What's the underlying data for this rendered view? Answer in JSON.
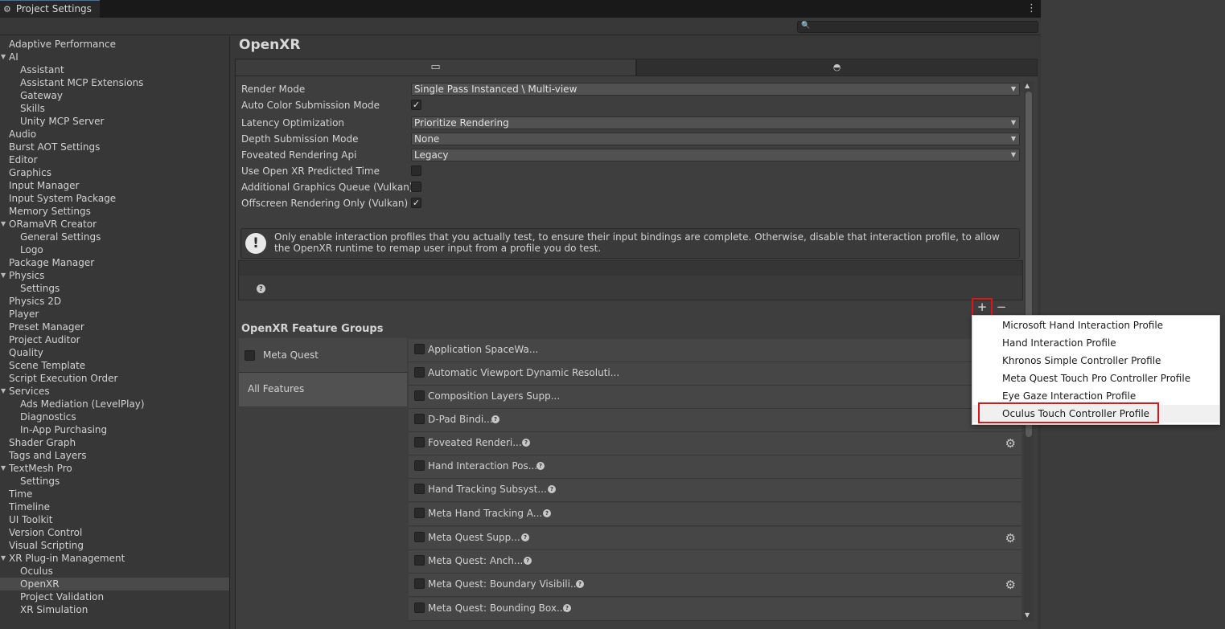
{
  "window": {
    "tab_title": "Project Settings",
    "tab_icon": "gear-icon",
    "menu_icon": "kebab-menu-icon",
    "search": {
      "placeholder": "",
      "value": ""
    }
  },
  "sidebar": {
    "items": [
      {
        "label": "Adaptive Performance",
        "indent": 0,
        "foldout": false
      },
      {
        "label": "AI",
        "indent": 0,
        "foldout": true
      },
      {
        "label": "Assistant",
        "indent": 1,
        "foldout": false
      },
      {
        "label": "Assistant MCP Extensions",
        "indent": 1,
        "foldout": false
      },
      {
        "label": "Gateway",
        "indent": 1,
        "foldout": false
      },
      {
        "label": "Skills",
        "indent": 1,
        "foldout": false
      },
      {
        "label": "Unity MCP Server",
        "indent": 1,
        "foldout": false
      },
      {
        "label": "Audio",
        "indent": 0,
        "foldout": false
      },
      {
        "label": "Burst AOT Settings",
        "indent": 0,
        "foldout": false
      },
      {
        "label": "Editor",
        "indent": 0,
        "foldout": false
      },
      {
        "label": "Graphics",
        "indent": 0,
        "foldout": false
      },
      {
        "label": "Input Manager",
        "indent": 0,
        "foldout": false
      },
      {
        "label": "Input System Package",
        "indent": 0,
        "foldout": false
      },
      {
        "label": "Memory Settings",
        "indent": 0,
        "foldout": false
      },
      {
        "label": "ORamaVR Creator",
        "indent": 0,
        "foldout": true
      },
      {
        "label": "General Settings",
        "indent": 1,
        "foldout": false
      },
      {
        "label": "Logo",
        "indent": 1,
        "foldout": false
      },
      {
        "label": "Package Manager",
        "indent": 0,
        "foldout": false
      },
      {
        "label": "Physics",
        "indent": 0,
        "foldout": true
      },
      {
        "label": "Settings",
        "indent": 1,
        "foldout": false
      },
      {
        "label": "Physics 2D",
        "indent": 0,
        "foldout": false
      },
      {
        "label": "Player",
        "indent": 0,
        "foldout": false
      },
      {
        "label": "Preset Manager",
        "indent": 0,
        "foldout": false
      },
      {
        "label": "Project Auditor",
        "indent": 0,
        "foldout": false
      },
      {
        "label": "Quality",
        "indent": 0,
        "foldout": false
      },
      {
        "label": "Scene Template",
        "indent": 0,
        "foldout": false
      },
      {
        "label": "Script Execution Order",
        "indent": 0,
        "foldout": false
      },
      {
        "label": "Services",
        "indent": 0,
        "foldout": true
      },
      {
        "label": "Ads Mediation (LevelPlay)",
        "indent": 1,
        "foldout": false
      },
      {
        "label": "Diagnostics",
        "indent": 1,
        "foldout": false
      },
      {
        "label": "In-App Purchasing",
        "indent": 1,
        "foldout": false
      },
      {
        "label": "Shader Graph",
        "indent": 0,
        "foldout": false
      },
      {
        "label": "Tags and Layers",
        "indent": 0,
        "foldout": false
      },
      {
        "label": "TextMesh Pro",
        "indent": 0,
        "foldout": true
      },
      {
        "label": "Settings",
        "indent": 1,
        "foldout": false
      },
      {
        "label": "Time",
        "indent": 0,
        "foldout": false
      },
      {
        "label": "Timeline",
        "indent": 0,
        "foldout": false
      },
      {
        "label": "UI Toolkit",
        "indent": 0,
        "foldout": false
      },
      {
        "label": "Version Control",
        "indent": 0,
        "foldout": false
      },
      {
        "label": "Visual Scripting",
        "indent": 0,
        "foldout": false
      },
      {
        "label": "XR Plug-in Management",
        "indent": 0,
        "foldout": true
      },
      {
        "label": "Oculus",
        "indent": 1,
        "foldout": false
      },
      {
        "label": "OpenXR",
        "indent": 1,
        "foldout": false,
        "selected": true
      },
      {
        "label": "Project Validation",
        "indent": 1,
        "foldout": false
      },
      {
        "label": "XR Simulation",
        "indent": 1,
        "foldout": false
      }
    ]
  },
  "page": {
    "title": "OpenXR",
    "platform_tabs": [
      {
        "icon": "desktop-icon",
        "glyph": "🖵",
        "active": true
      },
      {
        "icon": "android-icon",
        "glyph": "⌂",
        "active": false
      }
    ]
  },
  "settings": {
    "render_mode": {
      "label": "Render Mode",
      "value": "Single Pass Instanced \\ Multi-view"
    },
    "auto_color": {
      "label": "Auto Color Submission Mode",
      "checked": true
    },
    "latency": {
      "label": "Latency Optimization",
      "value": "Prioritize Rendering"
    },
    "depth": {
      "label": "Depth Submission Mode",
      "value": "None"
    },
    "foveated_api": {
      "label": "Foveated Rendering Api",
      "value": "Legacy"
    },
    "predicted_time": {
      "label": "Use Open XR Predicted Time",
      "checked": false
    },
    "graphics_queue": {
      "label": "Additional Graphics Queue (Vulkan)",
      "checked": false
    },
    "offscreen": {
      "label": "Offscreen Rendering Only (Vulkan)",
      "checked": true
    }
  },
  "interaction": {
    "help_text": "Only enable interaction profiles that you actually test, to ensure their input bindings are complete. Otherwise, disable that interaction profile, to allow the OpenXR runtime to remap user input from a profile you do test.",
    "add_label": "+",
    "remove_label": "−"
  },
  "feature_groups": {
    "title": "OpenXR Feature Groups",
    "groups": [
      {
        "label": "Meta Quest",
        "checked": false
      },
      {
        "label": "All Features",
        "selected": true
      }
    ],
    "features": [
      {
        "label": "Application SpaceWa...",
        "help": false,
        "gear": false
      },
      {
        "label": "Automatic Viewport Dynamic Resoluti...",
        "help": false,
        "gear": false
      },
      {
        "label": "Composition Layers Supp...",
        "help": false,
        "gear": false
      },
      {
        "label": "D-Pad Bindi...",
        "help": true,
        "gear": false
      },
      {
        "label": "Foveated Renderi...",
        "help": true,
        "gear": true
      },
      {
        "label": "Hand Interaction Pos...",
        "help": true,
        "gear": false
      },
      {
        "label": "Hand Tracking Subsyst...",
        "help": true,
        "gear": false
      },
      {
        "label": "Meta Hand Tracking A...",
        "help": true,
        "gear": false
      },
      {
        "label": "Meta Quest Supp...",
        "help": true,
        "gear": true
      },
      {
        "label": "Meta Quest: Anch...",
        "help": true,
        "gear": false
      },
      {
        "label": "Meta Quest: Boundary Visibili...",
        "help": true,
        "gear": true
      },
      {
        "label": "Meta Quest: Bounding Box...",
        "help": true,
        "gear": false
      }
    ]
  },
  "popup": {
    "items": [
      {
        "label": "Microsoft Hand Interaction Profile"
      },
      {
        "label": "Hand Interaction Profile"
      },
      {
        "label": "Khronos Simple Controller Profile"
      },
      {
        "label": "Meta Quest Touch Pro Controller Profile"
      },
      {
        "label": "Eye Gaze Interaction Profile"
      },
      {
        "label": "Oculus Touch Controller Profile",
        "highlighted": true
      }
    ]
  },
  "colors": {
    "highlight_box": "#e01414",
    "selected_row": "#4a4a4a",
    "tab_accent": "#3d6fb3"
  }
}
